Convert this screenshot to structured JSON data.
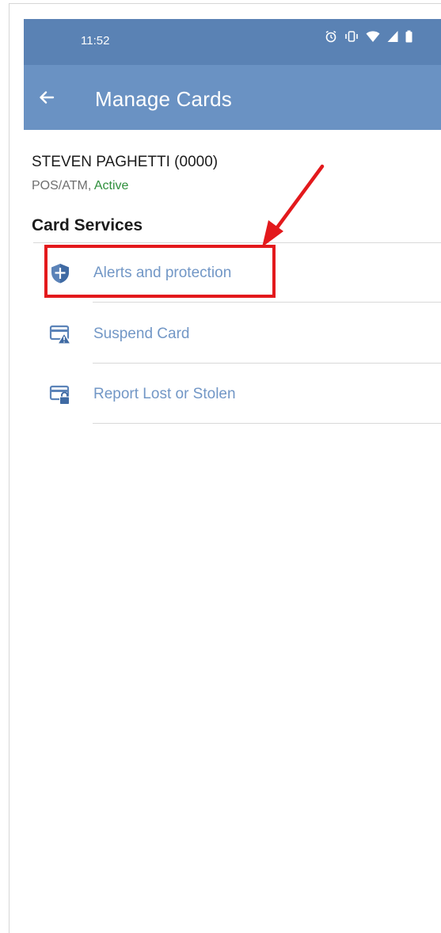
{
  "status_bar": {
    "time": "11:52",
    "icons": [
      "alarm-icon",
      "vibrate-icon",
      "wifi-icon",
      "signal-icon",
      "battery-icon"
    ]
  },
  "app_bar": {
    "title": "Manage Cards",
    "back_icon": "arrow-left-icon"
  },
  "card": {
    "name": "STEVEN PAGHETTI (0000)",
    "type": "POS/ATM, ",
    "status": "Active"
  },
  "card_services": {
    "title": "Card Services",
    "items": [
      {
        "label": "Alerts and protection",
        "icon": "shield-icon"
      },
      {
        "label": "Suspend Card",
        "icon": "card-warning-icon"
      },
      {
        "label": "Report Lost or Stolen",
        "icon": "card-lock-icon"
      }
    ]
  },
  "colors": {
    "status_bar": "#5a82b4",
    "app_bar": "#6a92c3",
    "link_text": "#7297c6",
    "active_status": "#2f8f3c",
    "annotation_red": "#e3191c"
  }
}
